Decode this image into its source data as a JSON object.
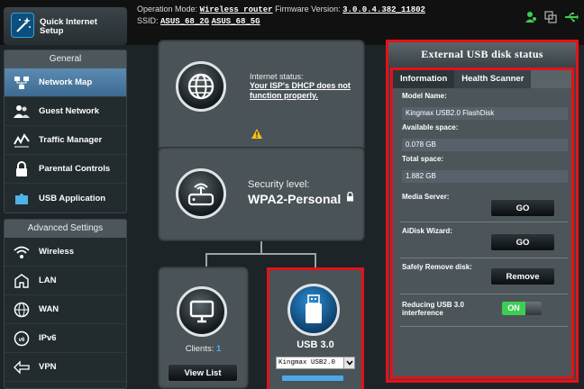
{
  "topbar": {
    "quick_internet_setup": "Quick Internet Setup",
    "op_mode_label": "Operation Mode:",
    "op_mode_value": "Wireless router",
    "firmware_label": "Firmware Version:",
    "firmware_value": "3.0.0.4.382_11802",
    "ssid_label": "SSID:",
    "ssid_1": "ASUS_68_2G",
    "ssid_2": "ASUS_68_5G"
  },
  "sidebar": {
    "general_title": "General",
    "general_items": [
      {
        "label": "Network Map",
        "icon": "network-map-icon",
        "active": true
      },
      {
        "label": "Guest Network",
        "icon": "guest-network-icon"
      },
      {
        "label": "Traffic Manager",
        "icon": "traffic-manager-icon"
      },
      {
        "label": "Parental Controls",
        "icon": "parental-controls-icon"
      },
      {
        "label": "USB Application",
        "icon": "usb-application-icon"
      }
    ],
    "advanced_title": "Advanced Settings",
    "advanced_items": [
      {
        "label": "Wireless",
        "icon": "wireless-icon"
      },
      {
        "label": "LAN",
        "icon": "lan-icon"
      },
      {
        "label": "WAN",
        "icon": "wan-icon"
      },
      {
        "label": "IPv6",
        "icon": "ipv6-icon"
      },
      {
        "label": "VPN",
        "icon": "vpn-icon"
      }
    ]
  },
  "map": {
    "internet_status_label": "Internet status:",
    "internet_status_msg": "Your ISP's DHCP does not function properly.",
    "security_label": "Security level:",
    "security_value": "WPA2-Personal",
    "clients_label": "Clients:",
    "clients_count": "1",
    "view_list": "View List",
    "usb_label": "USB 3.0",
    "usb_device_select": "Kingmax USB2.0"
  },
  "usb_panel": {
    "title": "External USB disk status",
    "tab_information": "Information",
    "tab_health": "Health Scanner",
    "model_label": "Model Name:",
    "model_value": "Kingmax USB2.0 FlashDisk",
    "available_label": "Available space:",
    "available_value": "0.078 GB",
    "total_label": "Total space:",
    "total_value": "1.882 GB",
    "media_server_label": "Media Server:",
    "media_server_btn": "GO",
    "aidisk_label": "AiDisk Wizard:",
    "aidisk_btn": "GO",
    "safely_remove_label": "Safely Remove disk:",
    "remove_btn": "Remove",
    "usb3_label": "Reducing USB 3.0 interference",
    "usb3_toggle": "ON"
  },
  "colors": {
    "accent_red": "#e4111a",
    "toggle_green": "#3bcf53",
    "active_nav": "#4a7ba3",
    "warning": "#f2c316"
  }
}
